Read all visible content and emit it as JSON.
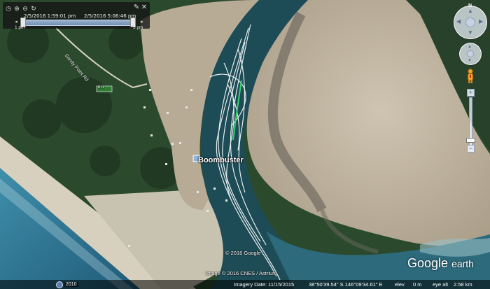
{
  "time_slider": {
    "start_datetime": "2/5/2016  1:59:01 pm",
    "end_datetime": "2/5/2016  5:06:46 pm",
    "start_label": "1 pm",
    "end_label": "5 pm",
    "tool_icons": [
      "clock-icon",
      "zoom-in-icon",
      "zoom-out-icon",
      "refresh-icon"
    ]
  },
  "map_labels": {
    "place": "Boombuster",
    "road": "Sandy Point Rd",
    "copyright_top": "© 2016 Google",
    "copyright_image": "Image © 2016 CNES / Astrium",
    "sign_marker": "ü ü"
  },
  "status_bar": {
    "tour_year": "2010",
    "imagery_date": "Imagery Date: 11/15/2015",
    "coordinates": "38°50'39.54\" S   146°09'34.61\" E",
    "elevation_label": "elev",
    "elevation_value": "0 m",
    "eye_alt_label": "eye alt",
    "eye_alt_value": "2.58 km"
  },
  "branding": {
    "logo_word1": "Google",
    "logo_word2": "earth"
  },
  "nav": {
    "look_icon": "compass-icon",
    "move_icon": "pan-icon",
    "person_icon": "street-view-pegman-icon",
    "zoom_in_label": "+",
    "zoom_out_label": "−"
  },
  "colors": {
    "sand": "#c9bca6",
    "channel": "#1d4c57",
    "forest": "#233c24",
    "ocean": "#2d7893",
    "track": "#ffffff",
    "track_highlight": "#39d46a"
  }
}
